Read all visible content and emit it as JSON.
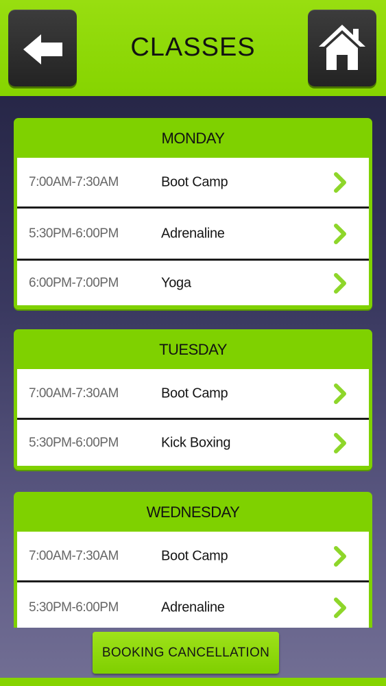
{
  "header": {
    "title": "CLASSES",
    "back_icon": "arrow-left-icon",
    "home_icon": "home-icon"
  },
  "days": [
    {
      "name": "MONDAY",
      "classes": [
        {
          "time": "7:00AM-7:30AM",
          "name": "Boot Camp"
        },
        {
          "time": "5:30PM-6:00PM",
          "name": "Adrenaline"
        },
        {
          "time": "6:00PM-7:00PM",
          "name": "Yoga"
        }
      ]
    },
    {
      "name": "TUESDAY",
      "classes": [
        {
          "time": "7:00AM-7:30AM",
          "name": "Boot Camp"
        },
        {
          "time": "5:30PM-6:00PM",
          "name": "Kick Boxing"
        }
      ]
    },
    {
      "name": "WEDNESDAY",
      "classes": [
        {
          "time": "7:00AM-7:30AM",
          "name": "Boot Camp"
        },
        {
          "time": "5:30PM-6:00PM",
          "name": "Adrenaline"
        }
      ]
    }
  ],
  "footer": {
    "booking_cancellation_label": "BOOKING CANCELLATION"
  },
  "colors": {
    "accent_green": "#86d400",
    "button_dark": "#2e2e2e",
    "chevron_green": "#8ed62a"
  }
}
